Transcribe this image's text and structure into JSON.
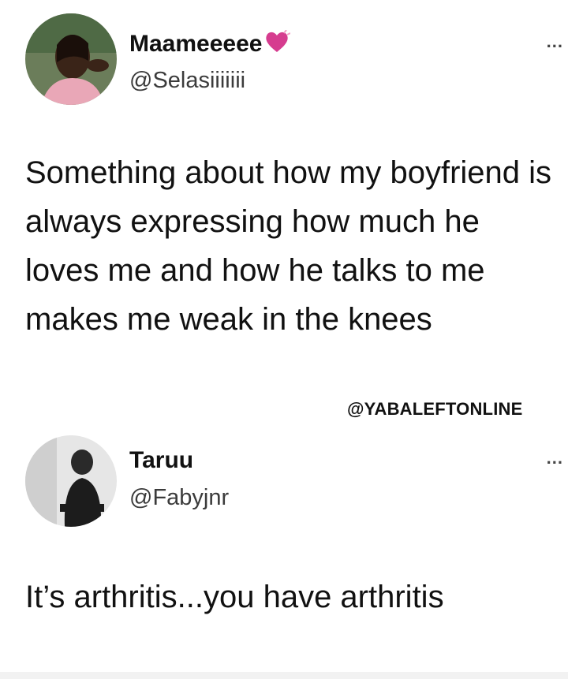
{
  "tweets": [
    {
      "display_name": "Maameeeee",
      "handle": "@Selasiiiiiii",
      "more_label": "...",
      "text": "Something about how my boyfriend is always expressing how much he loves me and how he talks to me makes me weak in the knees",
      "accent_color": "#d63c8f"
    },
    {
      "display_name": "Taruu",
      "handle": "@Fabyjnr",
      "more_label": "...",
      "text": "It’s arthritis...you have arthritis"
    }
  ],
  "watermark": "@YABALEFTONLINE"
}
